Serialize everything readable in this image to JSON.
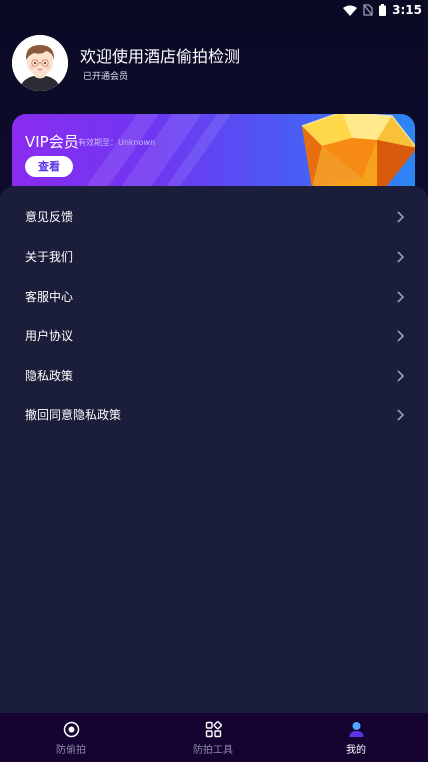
{
  "status_bar": {
    "time": "3:15"
  },
  "profile": {
    "welcome": "欢迎使用酒店偷拍检测",
    "member_status": "已开通会员"
  },
  "vip_card": {
    "title": "VIP会员",
    "expiry": "有效期至：Unknown",
    "view_button": "查看"
  },
  "menu": {
    "items": [
      {
        "label": "意见反馈"
      },
      {
        "label": "关于我们"
      },
      {
        "label": "客服中心"
      },
      {
        "label": "用户协议"
      },
      {
        "label": "隐私政策"
      },
      {
        "label": "撤回同意隐私政策"
      }
    ]
  },
  "bottom_nav": {
    "items": [
      {
        "label": "防偷拍",
        "icon": "camera-lens-icon"
      },
      {
        "label": "防拍工具",
        "icon": "grid-tools-icon"
      },
      {
        "label": "我的",
        "icon": "user-profile-icon",
        "active": true
      }
    ]
  },
  "colors": {
    "background": "#0b0a26",
    "panel": "#1b1e3a",
    "nav_bg": "#150332",
    "vip_gradient_start": "#8a2cf0",
    "vip_gradient_end": "#2b86f3",
    "accent": "#5b35e8"
  }
}
